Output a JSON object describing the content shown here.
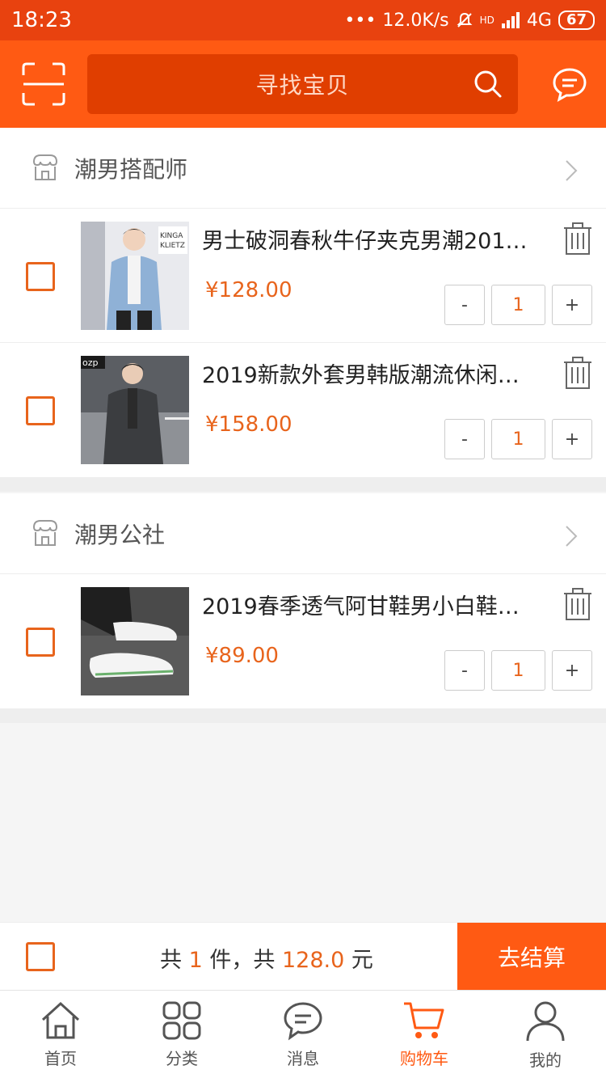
{
  "status_bar": {
    "time": "18:23",
    "network_speed": "12.0K/s",
    "network_type": "4G",
    "battery": "67",
    "hd_label": "HD"
  },
  "header": {
    "search_placeholder": "寻找宝贝",
    "scan_icon": "scan-icon",
    "message_icon": "chat-bubble-icon"
  },
  "stores": [
    {
      "name": "潮男搭配师",
      "items": [
        {
          "title": "男士破洞春秋牛仔夹克男潮201…",
          "price": "¥128.00",
          "qty": "1",
          "minus": "-",
          "plus": "+",
          "thumb_text": "KINGA KLIETZ"
        },
        {
          "title": "2019新款外套男韩版潮流休闲…",
          "price": "¥158.00",
          "qty": "1",
          "minus": "-",
          "plus": "+",
          "thumb_text": "ozp"
        }
      ]
    },
    {
      "name": "潮男公社",
      "items": [
        {
          "title": "2019春季透气阿甘鞋男小白鞋…",
          "price": "¥89.00",
          "qty": "1",
          "minus": "-",
          "plus": "+"
        }
      ]
    }
  ],
  "summary": {
    "prefix": "共",
    "count": "1",
    "mid": "件，共",
    "total": "128.0",
    "suffix": "元",
    "checkout_label": "去结算"
  },
  "tabs": [
    {
      "label": "首页",
      "icon": "home-icon"
    },
    {
      "label": "分类",
      "icon": "grid-icon"
    },
    {
      "label": "消息",
      "icon": "message-icon"
    },
    {
      "label": "购物车",
      "icon": "cart-icon",
      "active": true
    },
    {
      "label": "我的",
      "icon": "user-icon"
    }
  ],
  "colors": {
    "brand": "#ff5a13",
    "price": "#e8641c",
    "status_bar": "#e8420f"
  }
}
